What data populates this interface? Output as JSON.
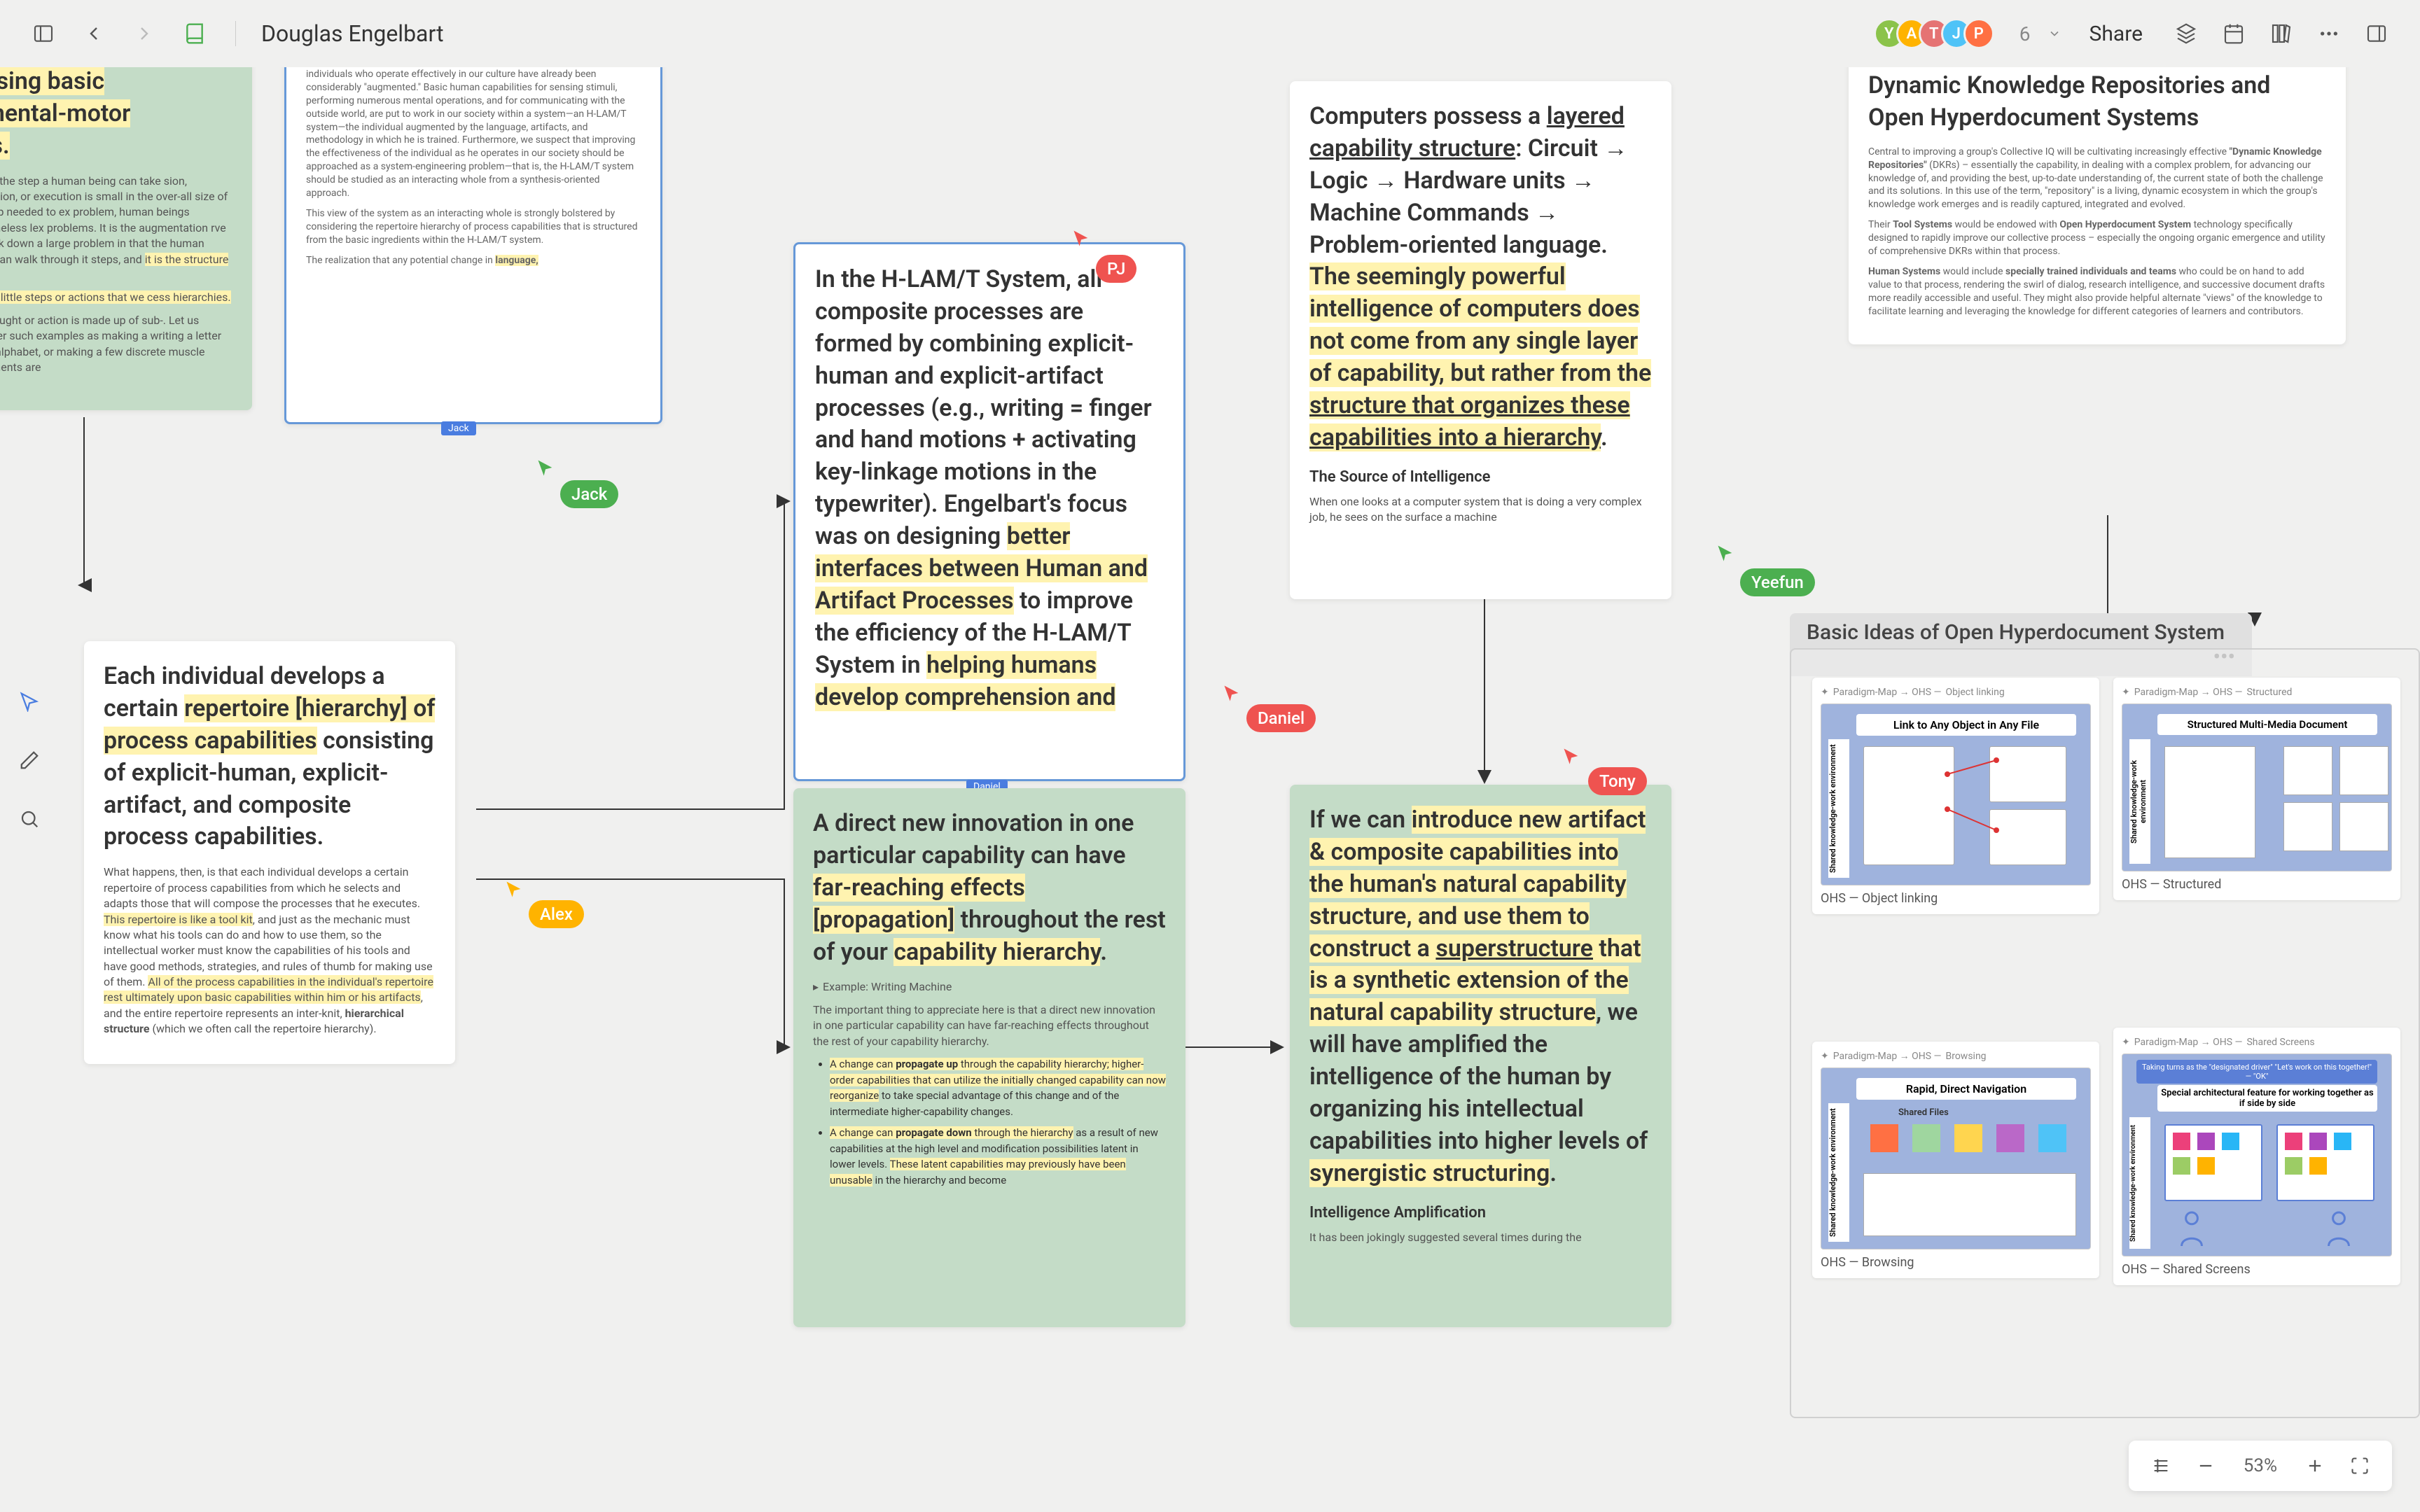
{
  "toolbar": {
    "title": "Douglas Engelbart",
    "share": "Share",
    "more_count": "6"
  },
  "avatars": [
    {
      "letter": "Y",
      "bg": "#8bc34a"
    },
    {
      "letter": "A",
      "bg": "#ffb300"
    },
    {
      "letter": "T",
      "bg": "#e57373"
    },
    {
      "letter": "J",
      "bg": "#4fc3f7"
    },
    {
      "letter": "P",
      "bg": "#ff7043"
    }
  ],
  "cursors": {
    "alex": "Alex",
    "jack": "Jack",
    "pj": "PJ",
    "daniel": "Daniel",
    "tony": "Tony",
    "yeefun": "Yeefun"
  },
  "user_labels": {
    "jack": "Jack",
    "daniel": "Daniel"
  },
  "card_a": {
    "frag1": "d using basic",
    "frag2": "y-mental-motor",
    "frag3": "ties.",
    "body1": "size of the step a human being can take sion, innovation, or execution is small in the over-all size of the step needed to ex problem, human beings nevertheless lex problems. It is the augmentation rve to break down a large problem in that the human being can walk through it steps, and ",
    "body1_hl": "it is the structure or",
    "body2_hl": "f these little steps or actions that we cess hierarchies.",
    "body3": "t of thought or action is made up of sub-. Let us consider such examples as making a writing a letter of the alphabet, or making a few discrete muscle movements are"
  },
  "card_b": {
    "p1": "individuals who operate effectively in our culture have already been considerably \"augmented.\" Basic human capabilities for sensing stimuli, performing numerous mental operations, and for communicating with the outside world, are put to work in our society within a system—an H-LAM/T system—the individual augmented by the language, artifacts, and methodology in which he is trained. Furthermore, we suspect that improving the effectiveness of the individual as he operates in our society should be approached as a system-engineering problem—that is, the H-LAM/T system should be studied as an interacting whole from a synthesis-oriented approach.",
    "p2": "This view of the system as an interacting whole is strongly bolstered by considering the repertoire hierarchy of process capabilities that is structured from the basic ingredients within the H-LAM/T system.",
    "p3a": "The realization that any potential change in ",
    "p3b": "language,"
  },
  "card_c": {
    "t1": "Each individual develops a certain ",
    "t2": "repertoire [hierarchy] of process capabilities",
    "t3": " consisting of explicit-human, explicit-artifact, and composite process capabilities.",
    "p1": "What happens, then, is that each individual develops a certain repertoire of process capabilities from which he selects and adapts those that will compose the processes that he executes. ",
    "p1hl": "This repertoire is like a tool kit",
    "p1b": ", and just as the mechanic must know what his tools can do and how to use them, so the intellectual worker must know the capabilities of his tools and have good methods, strategies, and rules of thumb for making use of them. ",
    "p1hl2": "All of the process capabilities in the individual's repertoire rest ultimately upon basic capabilities within him or his artifacts",
    "p1c": ", and the entire repertoire represents an inter-knit, ",
    "p1d": "hierarchical structure",
    "p1e": " (which we often call the repertoire hierarchy)."
  },
  "card_d": {
    "t1": "In the H-LAM/T System, all composite processes are formed by combining explicit-human and explicit-artifact processes (e.g., writing = finger and hand motions + activating key-linkage motions in the typewriter). Engelbart's focus was on designing ",
    "t2": "better interfaces between Human and Artifact Processes",
    "t3": " to improve the efficiency of the H-LAM/T System in ",
    "t4": "helping humans develop comprehension and"
  },
  "card_e": {
    "t1": "A direct new innovation in one particular capability can have ",
    "t2": "far-reaching effects [propagation]",
    "t3": " throughout the rest of your ",
    "t4": "capability hierarchy",
    "t5": ".",
    "ex": "Example: Writing Machine",
    "p1": "The important thing to appreciate here is that a direct new innovation in one particular capability can have far-reaching effects throughout the rest of your capability hierarchy.",
    "b1a": "A change can ",
    "b1b": "propagate up",
    "b1c": " through the capability hierarchy; higher-order capabilities that can utilize the initially changed capability can now reorganize",
    "b1d": " to take special advantage of this change and of the intermediate higher-capability changes.",
    "b2a": "A change can ",
    "b2b": "propagate down",
    "b2c": " through the hierarchy",
    "b2d": " as a result of new capabilities at the high level and modification possibilities latent in lower levels. ",
    "b2e": "These latent capabilities may previously have been unusable",
    "b2f": " in the hierarchy and become"
  },
  "card_f": {
    "t1": "Computers possess a ",
    "t2": "layered capability structure",
    "t3": ": Circuit → Logic → Hardware units → Machine Commands → Problem-oriented language. ",
    "t4": "The seemingly powerful intelligence of computers does not come from any single layer of capability, but rather from the ",
    "t5": "structure that organizes these capabilities into a hierarchy",
    "t6": ".",
    "h3": "The Source of Intelligence",
    "p1": "When one looks at a computer system that is doing a very complex job, he sees on the surface a machine"
  },
  "card_g": {
    "t1": "If we can ",
    "t2": "introduce new artifact & composite capabilities into the human's natural capability structure, and use them to construct a ",
    "t3": "superstructure",
    "t4": " that is a synthetic extension of the natural capability structure",
    "t5": ", we will have amplified the intelligence of the human by organizing his intellectual capabilities into higher levels of ",
    "t6": "synergistic structuring",
    "t7": ".",
    "h3": "Intelligence Amplification",
    "p1": "It has been jokingly suggested several times during the"
  },
  "card_h": {
    "title": "Dynamic Knowledge Repositories and Open Hyperdocument Systems",
    "p1a": "Central to improving a group's Collective IQ will be cultivating increasingly effective ",
    "p1b": "\"Dynamic Knowledge Repositories\"",
    "p1c": " (DKRs) – essentially the capability, in dealing with a complex problem, for advancing our knowledge of, and providing the best, up-to-date understanding of, the current state of both the challenge and its solutions. In this use of the term, \"repository\" is a living, dynamic ecosystem in which the group's knowledge work emerges and is readily captured, integrated and evolved.",
    "p2a": "Their ",
    "p2b": "Tool Systems",
    "p2c": " would be endowed with ",
    "p2d": "Open Hyperdocument System",
    "p2e": " technology specifically designed to rapidly improve our collective process – especially the ongoing organic emergence and utility of comprehensive DKRs within that process.",
    "p3a": "Human Systems",
    "p3b": " would include ",
    "p3c": "specially trained individuals and teams",
    "p3d": " who could be on hand to add value to that process, rendering the swirl of dialog, research intelligence, and successive document drafts more readily accessible and useful. They might also provide helpful alternate \"views\" of the knowledge to facilitate learning and leveraging the knowledge for different categories of learners and contributors."
  },
  "group": {
    "title": "Basic Ideas of Open Hyperdocument System",
    "bc_prefix": "Paradigm-Map → OHS — ",
    "thumbs": [
      {
        "bc": "Object linking",
        "label": "OHS — Object linking",
        "banner": "Link to Any Object in Any File"
      },
      {
        "bc": "Structured",
        "label": "OHS — Structured",
        "banner": "Structured Multi-Media Document"
      },
      {
        "bc": "Browsing",
        "label": "OHS — Browsing",
        "banner": "Rapid, Direct Navigation"
      },
      {
        "bc": "Shared Screens",
        "label": "OHS — Shared Screens",
        "banner": "Special architectural feature for working together as if side by side"
      }
    ],
    "thumb3_sub": "Shared Files",
    "thumb4_top": "Taking turns as the \"designated driver\" \"Let's work on this together!\" — \"OK\""
  },
  "zoom": "53%",
  "side_label": "Shared knowledge-work environment"
}
